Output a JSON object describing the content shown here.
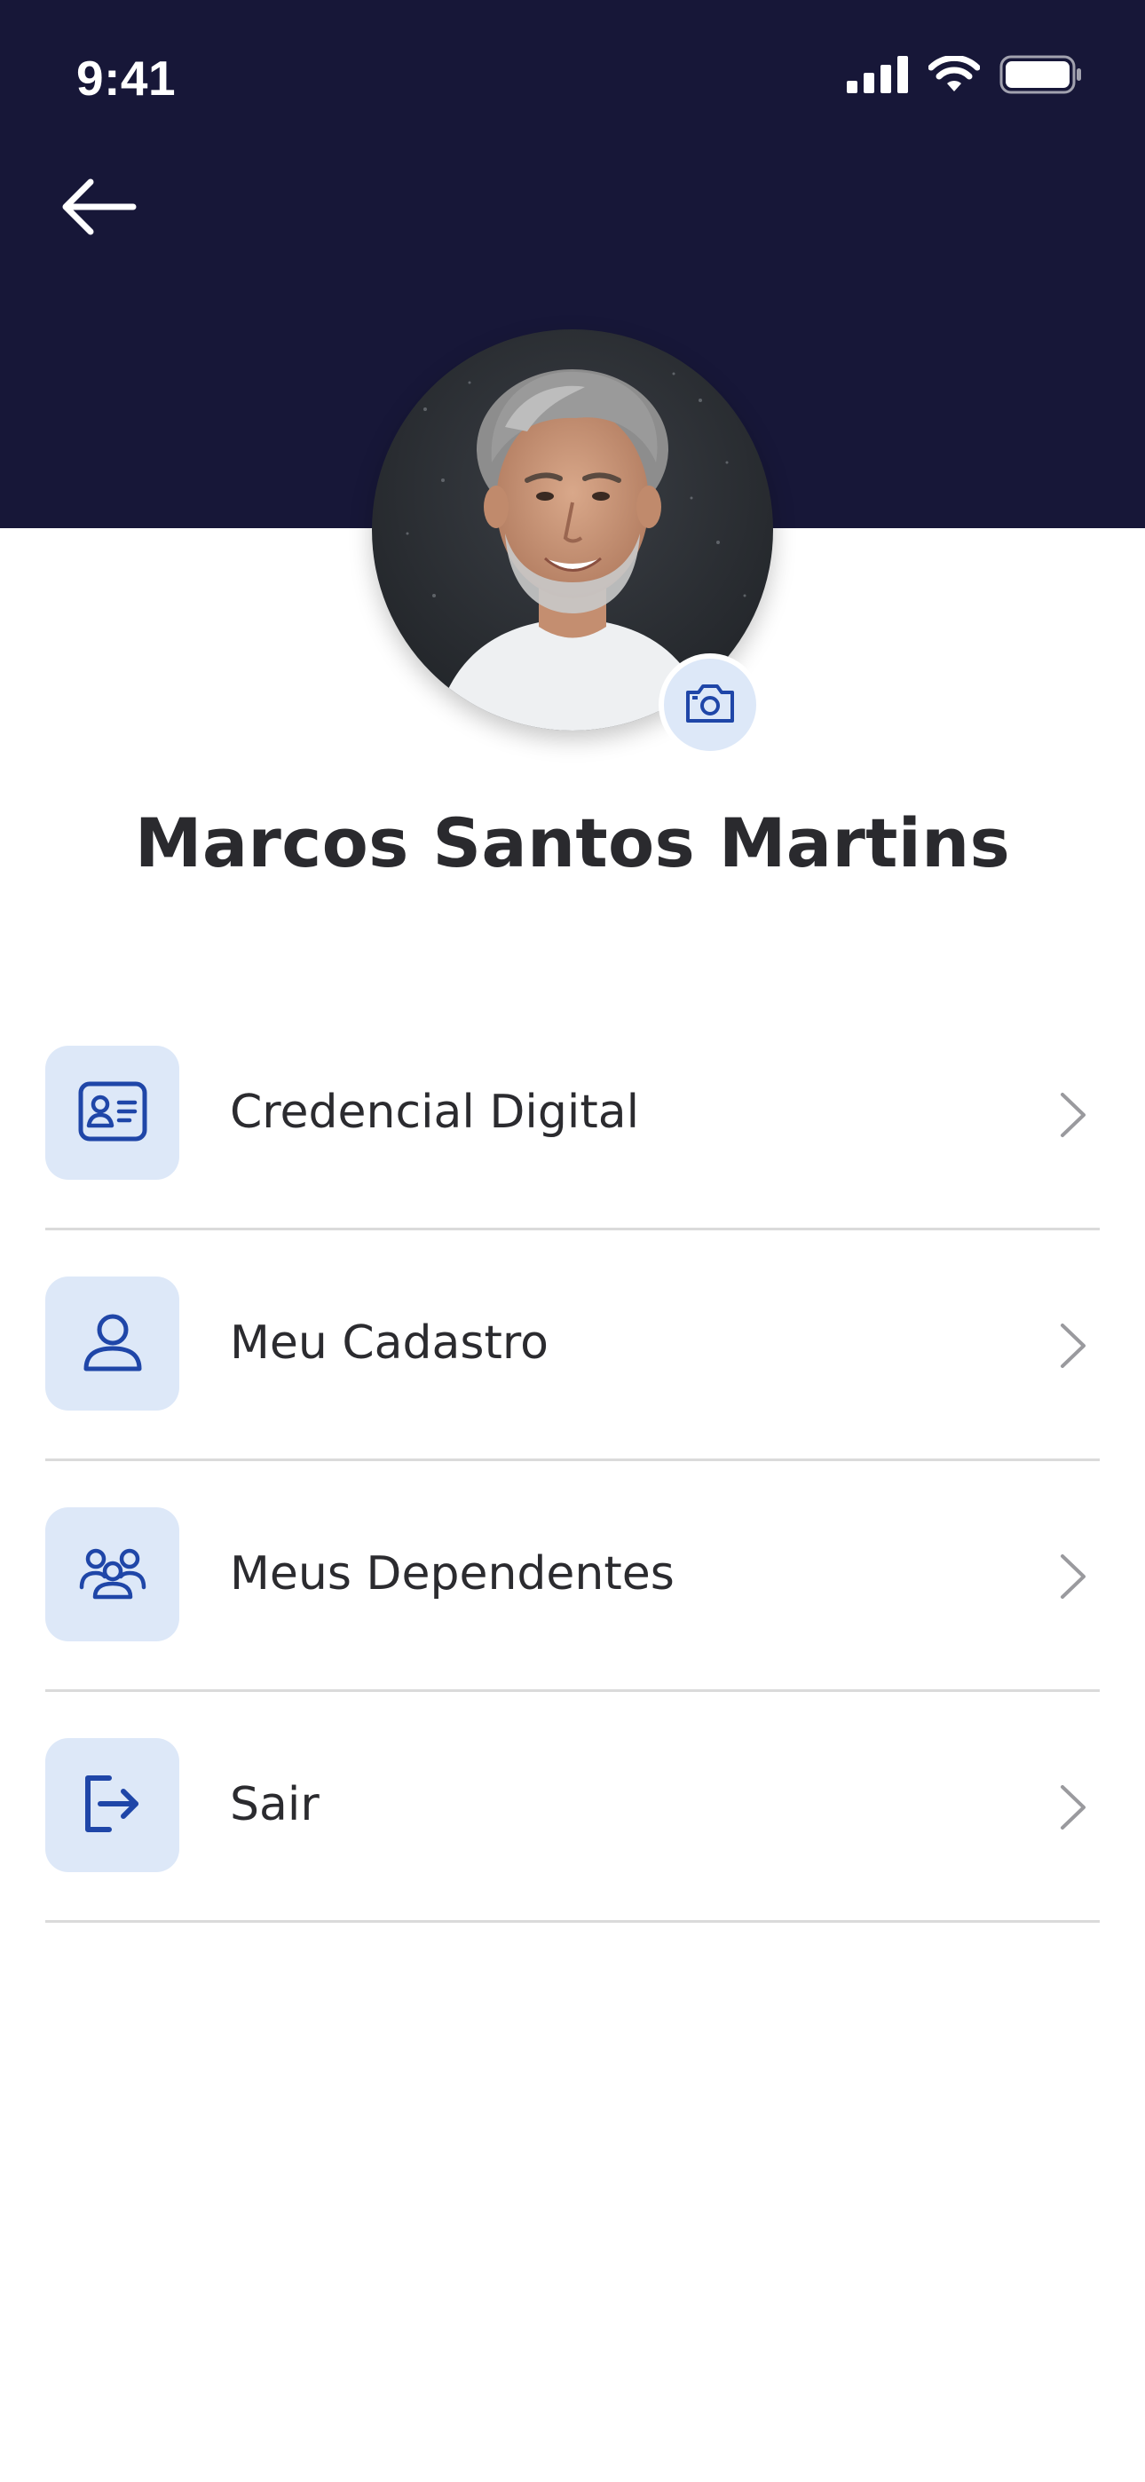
{
  "status_bar": {
    "time": "9:41",
    "icons": [
      "cellular-signal-icon",
      "wifi-icon",
      "battery-icon"
    ]
  },
  "header": {
    "background_color": "#171738",
    "back_icon": "arrow-left-icon"
  },
  "profile": {
    "name": "Marcos Santos Martins",
    "avatar": "avatar-photo",
    "camera_icon": "camera-icon"
  },
  "menu": {
    "items": [
      {
        "label": "Credencial Digital",
        "icon": "id-card-icon"
      },
      {
        "label": "Meu Cadastro",
        "icon": "user-icon"
      },
      {
        "label": "Meus Dependentes",
        "icon": "users-group-icon"
      },
      {
        "label": "Sair",
        "icon": "logout-icon"
      }
    ],
    "chevron_icon": "chevron-right-icon"
  },
  "colors": {
    "accent": "#1f46a8",
    "icon_background": "#dde8f8",
    "divider": "#dadada",
    "chevron": "#9a9a9e"
  }
}
